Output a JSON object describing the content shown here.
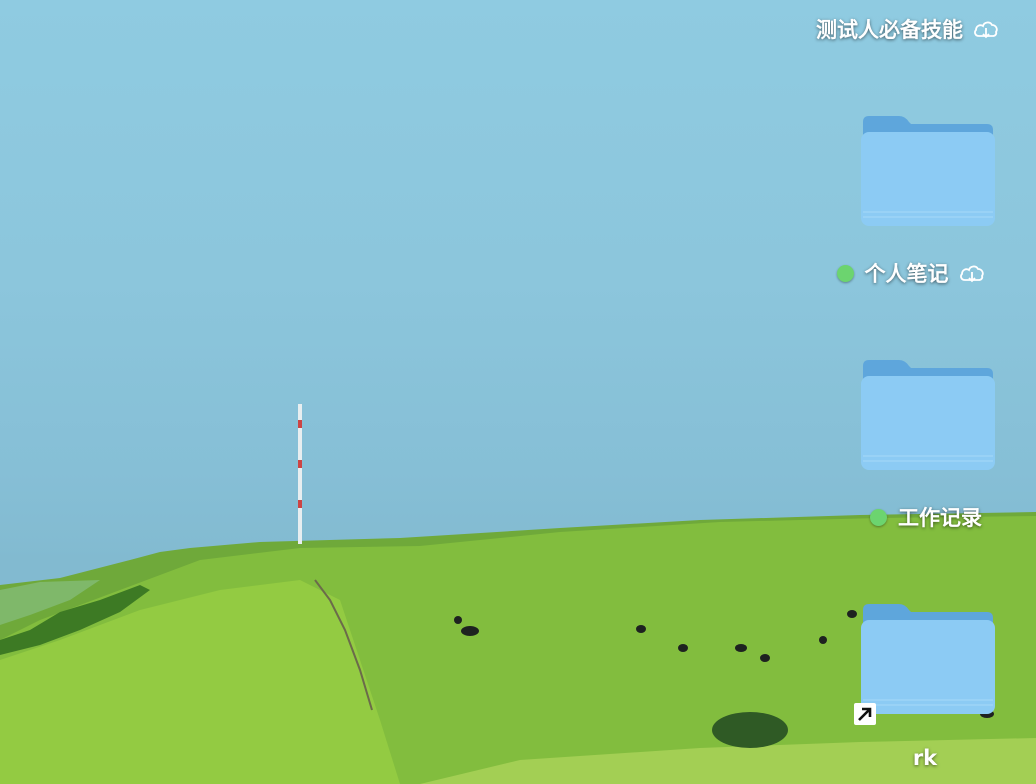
{
  "desktop": {
    "items": [
      {
        "label": "测试人必备技能",
        "tag_color": null,
        "icon": "cloud-download-icon",
        "kind": "folder"
      },
      {
        "label": "个人笔记",
        "tag_color": "#6cd46f",
        "icon": "cloud-download-icon",
        "kind": "folder"
      },
      {
        "label": "工作记录",
        "tag_color": "#6cd46f",
        "icon": null,
        "kind": "folder"
      },
      {
        "label": "rk",
        "tag_color": null,
        "icon": "alias-arrow-icon",
        "kind": "folder-alias"
      }
    ]
  },
  "colors": {
    "folder_body": "#8ccbf4",
    "folder_tab": "#5ea6dc",
    "tag_green": "#6cd46f",
    "sky": "#8cc6dc",
    "grass": "#86bf3c"
  }
}
